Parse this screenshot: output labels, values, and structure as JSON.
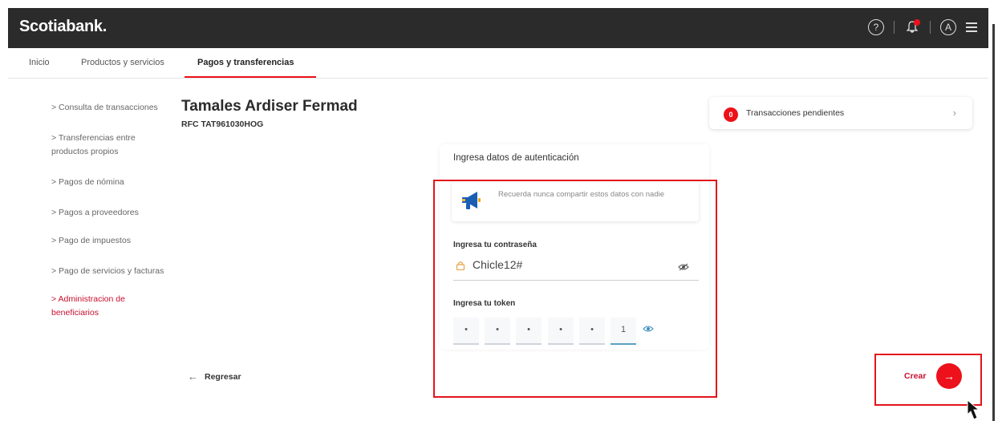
{
  "header": {
    "logo": "Scotiabank.",
    "icons": [
      "help-icon",
      "notification-bell-icon",
      "user-avatar-icon",
      "menu-icon"
    ],
    "avatar_letter": "A",
    "help_symbol": "?"
  },
  "nav": {
    "tabs": [
      {
        "label": "Inicio"
      },
      {
        "label": "Productos y servicios"
      },
      {
        "label": "Pagos y transferencias",
        "active": true
      }
    ]
  },
  "sidebar": {
    "items": [
      {
        "label": "> Consulta de transacciones"
      },
      {
        "label": "> Transferencias entre productos propios"
      },
      {
        "label": "> Pagos de nómina"
      },
      {
        "label": "> Pagos a proveedores"
      },
      {
        "label": "> Pago de impuestos"
      },
      {
        "label": "> Pago de servicios y facturas"
      },
      {
        "label": "> Administracion de beneficiarios",
        "active": true
      }
    ]
  },
  "main": {
    "title": "Tamales Ardiser Fermad",
    "rfc": "RFC TAT961030HOG",
    "back_label": "Regresar",
    "back_arrow": "←"
  },
  "pending": {
    "badge": "0",
    "label": "Transacciones pendientes",
    "chevron": "›"
  },
  "auth": {
    "heading": "Ingresa datos de autenticación",
    "notice": "Recuerda nunca compartir estos datos con nadie",
    "password_label": "Ingresa tu contraseña",
    "password_value": "Chicle12#",
    "token_label": "Ingresa tu token",
    "token_digits": [
      "•",
      "•",
      "•",
      "•",
      "•",
      "1"
    ]
  },
  "actions": {
    "create_label": "Crear",
    "create_arrow": "→"
  },
  "colors": {
    "brand_red": "#ec111a",
    "topbar": "#2b2b2b",
    "highlight_box": "#e3141b"
  }
}
